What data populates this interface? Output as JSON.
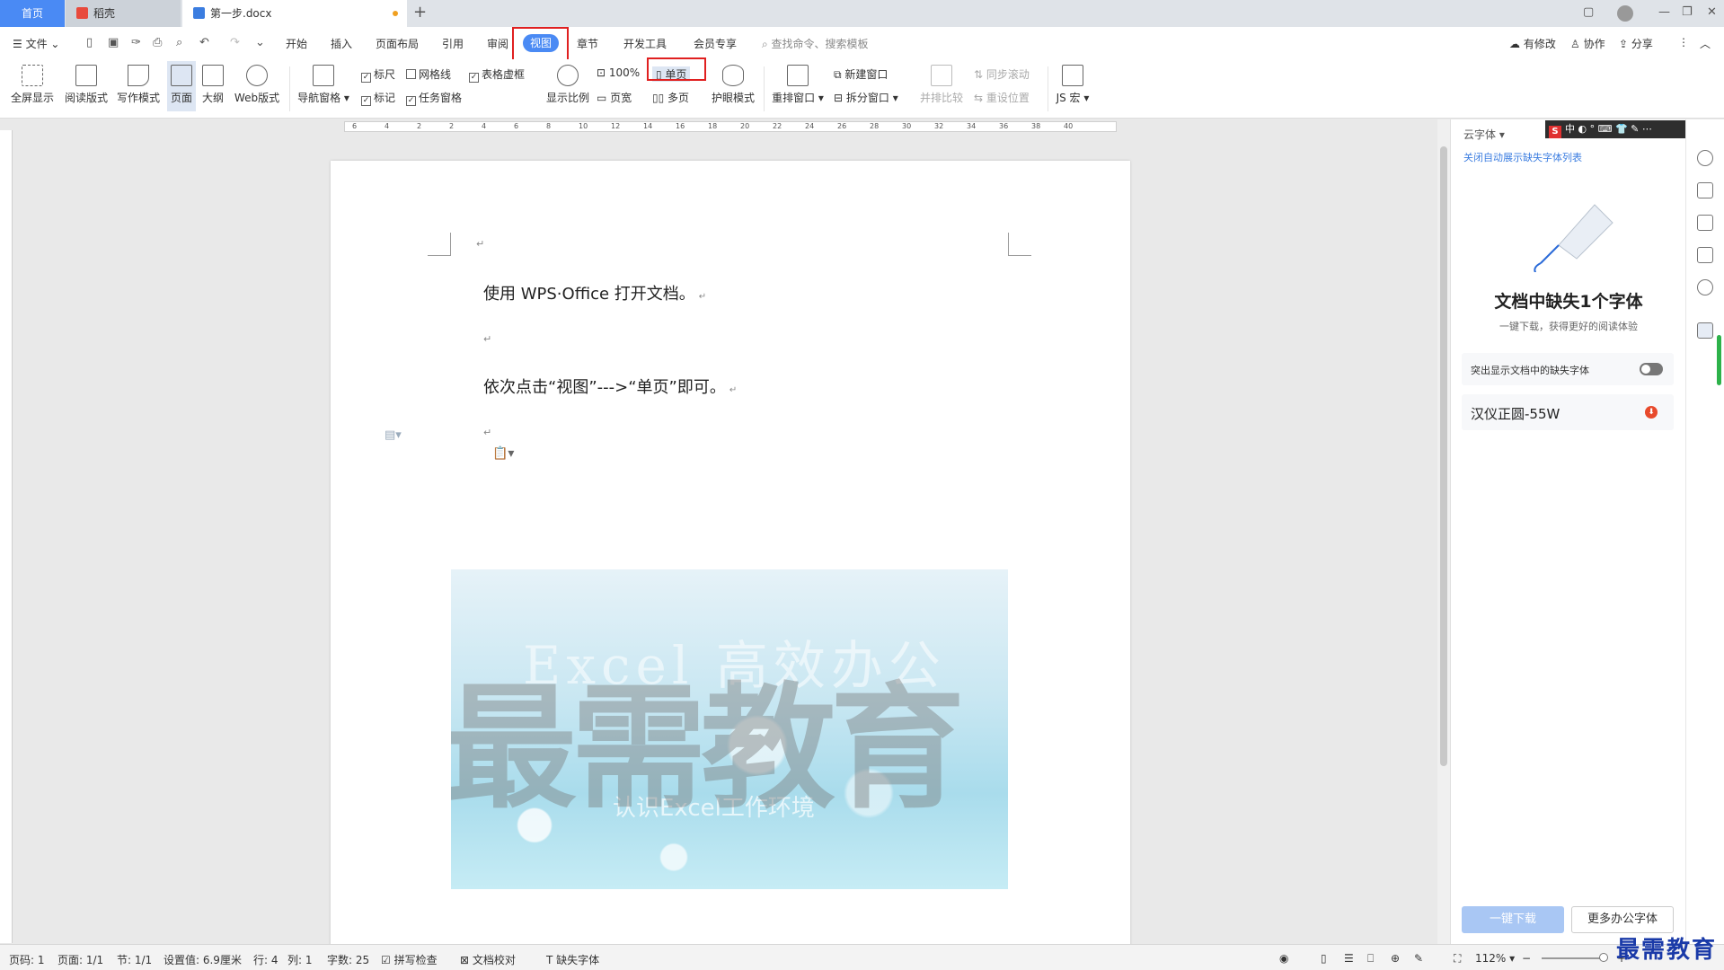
{
  "tabs": {
    "home": "首页",
    "daoke": "稻壳",
    "doc": "第一步.docx",
    "add": "+"
  },
  "menu": {
    "file": "文件",
    "items": [
      "开始",
      "插入",
      "页面布局",
      "引用",
      "审阅",
      "视图",
      "章节",
      "开发工具",
      "会员专享"
    ],
    "search_placeholder": "查找命令、搜索模板",
    "modified": "有修改",
    "collab": "协作",
    "share": "分享"
  },
  "ribbon": {
    "fullscreen": "全屏显示",
    "read_mode": "阅读版式",
    "write_mode": "写作模式",
    "page": "页面",
    "outline": "大纲",
    "web": "Web版式",
    "nav_pane": "导航窗格",
    "ruler": "标尺",
    "gridlines": "网格线",
    "table_grid": "表格虚框",
    "marks": "标记",
    "task_pane": "任务窗格",
    "zoom_display": "显示比例",
    "zoom_100": "100%",
    "page_width": "页宽",
    "single_page": "单页",
    "multi_page": "多页",
    "eye_mode": "护眼模式",
    "rearrange": "重排窗口",
    "new_window": "新建窗口",
    "split_window": "拆分窗口",
    "side_by_side": "并排比较",
    "sync_scroll": "同步滚动",
    "reset_pos": "重设位置",
    "macro": "JS 宏"
  },
  "ruler_labels": [
    "6",
    "4",
    "2",
    "2",
    "4",
    "6",
    "8",
    "10",
    "12",
    "14",
    "16",
    "18",
    "20",
    "22",
    "24",
    "26",
    "28",
    "30",
    "32",
    "34",
    "36",
    "38",
    "40"
  ],
  "document": {
    "line1": "使用 WPS·Office 打开文档。",
    "line2": "依次点击“视图”--->“单页”即可。",
    "banner_title": "Excel 高效办公",
    "banner_subtitle": "认识Excel工作环境",
    "watermark": "最需教育"
  },
  "panel": {
    "header": "云字体",
    "close_link": "关闭自动展示缺失字体列表",
    "title": "文档中缺失1个字体",
    "subtitle": "一键下载，获得更好的阅读体验",
    "highlight_toggle": "突出显示文档中的缺失字体",
    "font_name": "汉仪正圆-55W",
    "download_btn": "一键下载",
    "more_btn": "更多办公字体"
  },
  "ime": {
    "badge": "S",
    "text": "中 ◐ ° ⌨ 👕 ✎ ⋯"
  },
  "status": {
    "page_num": "页码: 1",
    "pages": "页面: 1/1",
    "section": "节: 1/1",
    "setting": "设置值: 6.9厘米",
    "row": "行: 4",
    "col": "列: 1",
    "words": "字数: 25",
    "spell": "拼写检查",
    "proof": "文档校对",
    "missing_font": "缺失字体",
    "zoom": "112%"
  },
  "corner_watermark": "最需教育",
  "colors": {
    "accent": "#4a8af4",
    "highlight_box": "#e02020",
    "watermark_blue": "#1a3aa8"
  }
}
